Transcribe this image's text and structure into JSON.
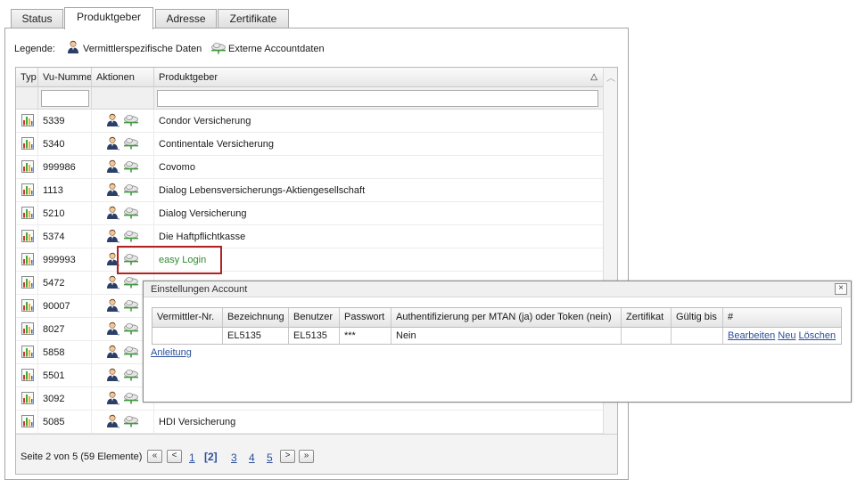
{
  "tabs": [
    {
      "label": "Status",
      "active": false
    },
    {
      "label": "Produktgeber",
      "active": true
    },
    {
      "label": "Adresse",
      "active": false
    },
    {
      "label": "Zertifikate",
      "active": false
    }
  ],
  "legend": {
    "label": "Legende:",
    "agent_label": "Vermittlerspezifische Daten",
    "cloud_label": "Externe Accountdaten"
  },
  "grid": {
    "columns": {
      "typ": "Typ",
      "vu_nummer": "Vu-Nummer",
      "aktionen": "Aktionen",
      "produktgeber": "Produktgeber"
    },
    "sort_indicator": "△",
    "filters": {
      "vu_nummer": "",
      "produktgeber": ""
    },
    "rows": [
      {
        "nr": "5339",
        "name": "Condor Versicherung"
      },
      {
        "nr": "5340",
        "name": "Continentale Versicherung"
      },
      {
        "nr": "999986",
        "name": "Covomo"
      },
      {
        "nr": "1113",
        "name": "Dialog Lebensversicherungs-Aktiengesellschaft"
      },
      {
        "nr": "5210",
        "name": "Dialog Versicherung"
      },
      {
        "nr": "5374",
        "name": "Die Haftpflichtkasse"
      },
      {
        "nr": "999993",
        "name": "easy Login"
      },
      {
        "nr": "5472",
        "name": ""
      },
      {
        "nr": "90007",
        "name": ""
      },
      {
        "nr": "8027",
        "name": ""
      },
      {
        "nr": "5858",
        "name": ""
      },
      {
        "nr": "5501",
        "name": ""
      },
      {
        "nr": "3092",
        "name": ""
      },
      {
        "nr": "5085",
        "name": "HDI Versicherung"
      }
    ]
  },
  "pager": {
    "info": "Seite 2 von 5 (59 Elemente)",
    "first": "«",
    "prev": "<",
    "pages": [
      "1",
      "[2]",
      "3",
      "4",
      "5"
    ],
    "next": ">",
    "last": "»"
  },
  "dialog": {
    "title": "Einstellungen Account",
    "close": "×",
    "columns": [
      "Vermittler-Nr.",
      "Bezeichnung",
      "Benutzer",
      "Passwort",
      "Authentifizierung per MTAN (ja) oder Token (nein)",
      "Zertifikat",
      "Gültig bis",
      "#"
    ],
    "row": {
      "vermittler_nr": "",
      "bezeichnung": "EL5135",
      "benutzer": "EL5135",
      "passwort": "***",
      "auth": "Nein",
      "zertifikat": "",
      "gueltig_bis": "",
      "actions": {
        "edit": "Bearbeiten",
        "new": "Neu",
        "delete": "Löschen"
      }
    },
    "help_link": "Anleitung"
  },
  "colors": {
    "highlight_border": "#b22222",
    "link": "#2a4f9a",
    "active_name": "#2e8b2e"
  }
}
